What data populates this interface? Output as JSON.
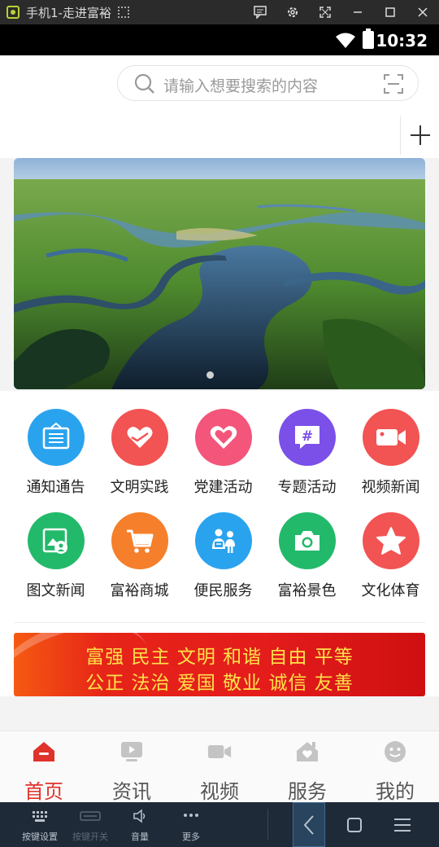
{
  "emulator": {
    "title": "手机1-走进富裕",
    "controls": [
      "message-icon",
      "gear-icon",
      "fullscreen-icon",
      "minimize-icon",
      "maximize-icon",
      "close-icon"
    ],
    "bottom": {
      "keymap_label": "按键设置",
      "keyswitch_label": "按键开关",
      "volume_label": "音量",
      "more_label": "更多"
    }
  },
  "status_bar": {
    "time": "10:32"
  },
  "search": {
    "placeholder": "请输入想要搜索的内容"
  },
  "banner": {
    "slide_count": 1,
    "active_slide": 1
  },
  "grid": [
    {
      "label": "通知通告",
      "icon": "notice-board-icon",
      "color": "#2aa3ee"
    },
    {
      "label": "文明实践",
      "icon": "heart-hands-icon",
      "color": "#f25353"
    },
    {
      "label": "党建活动",
      "icon": "heart-icon",
      "color": "#f4557a"
    },
    {
      "label": "专题活动",
      "icon": "hashtag-chat-icon",
      "color": "#7a50e8"
    },
    {
      "label": "视频新闻",
      "icon": "video-camera-icon",
      "color": "#f25353"
    },
    {
      "label": "图文新闻",
      "icon": "image-news-icon",
      "color": "#23b96a"
    },
    {
      "label": "富裕商城",
      "icon": "shopping-cart-icon",
      "color": "#f57f2a"
    },
    {
      "label": "便民服务",
      "icon": "service-people-icon",
      "color": "#2aa3ee"
    },
    {
      "label": "富裕景色",
      "icon": "camera-icon",
      "color": "#23b96a"
    },
    {
      "label": "文化体育",
      "icon": "star-icon",
      "color": "#f25353"
    }
  ],
  "slogan": {
    "line1": "富强  民主  文明  和谐  自由  平等",
    "line2": "公正  法治  爱国  敬业  诚信  友善"
  },
  "tabs": [
    {
      "label": "首页",
      "icon": "home-icon",
      "active": true
    },
    {
      "label": "资讯",
      "icon": "play-screen-icon",
      "active": false
    },
    {
      "label": "视频",
      "icon": "video-icon",
      "active": false
    },
    {
      "label": "服务",
      "icon": "house-heart-icon",
      "active": false
    },
    {
      "label": "我的",
      "icon": "smile-face-icon",
      "active": false
    }
  ],
  "colors": {
    "accent": "#e0322b",
    "tab_inactive": "#c4c4c4",
    "slogan_text": "#ffe14a"
  }
}
